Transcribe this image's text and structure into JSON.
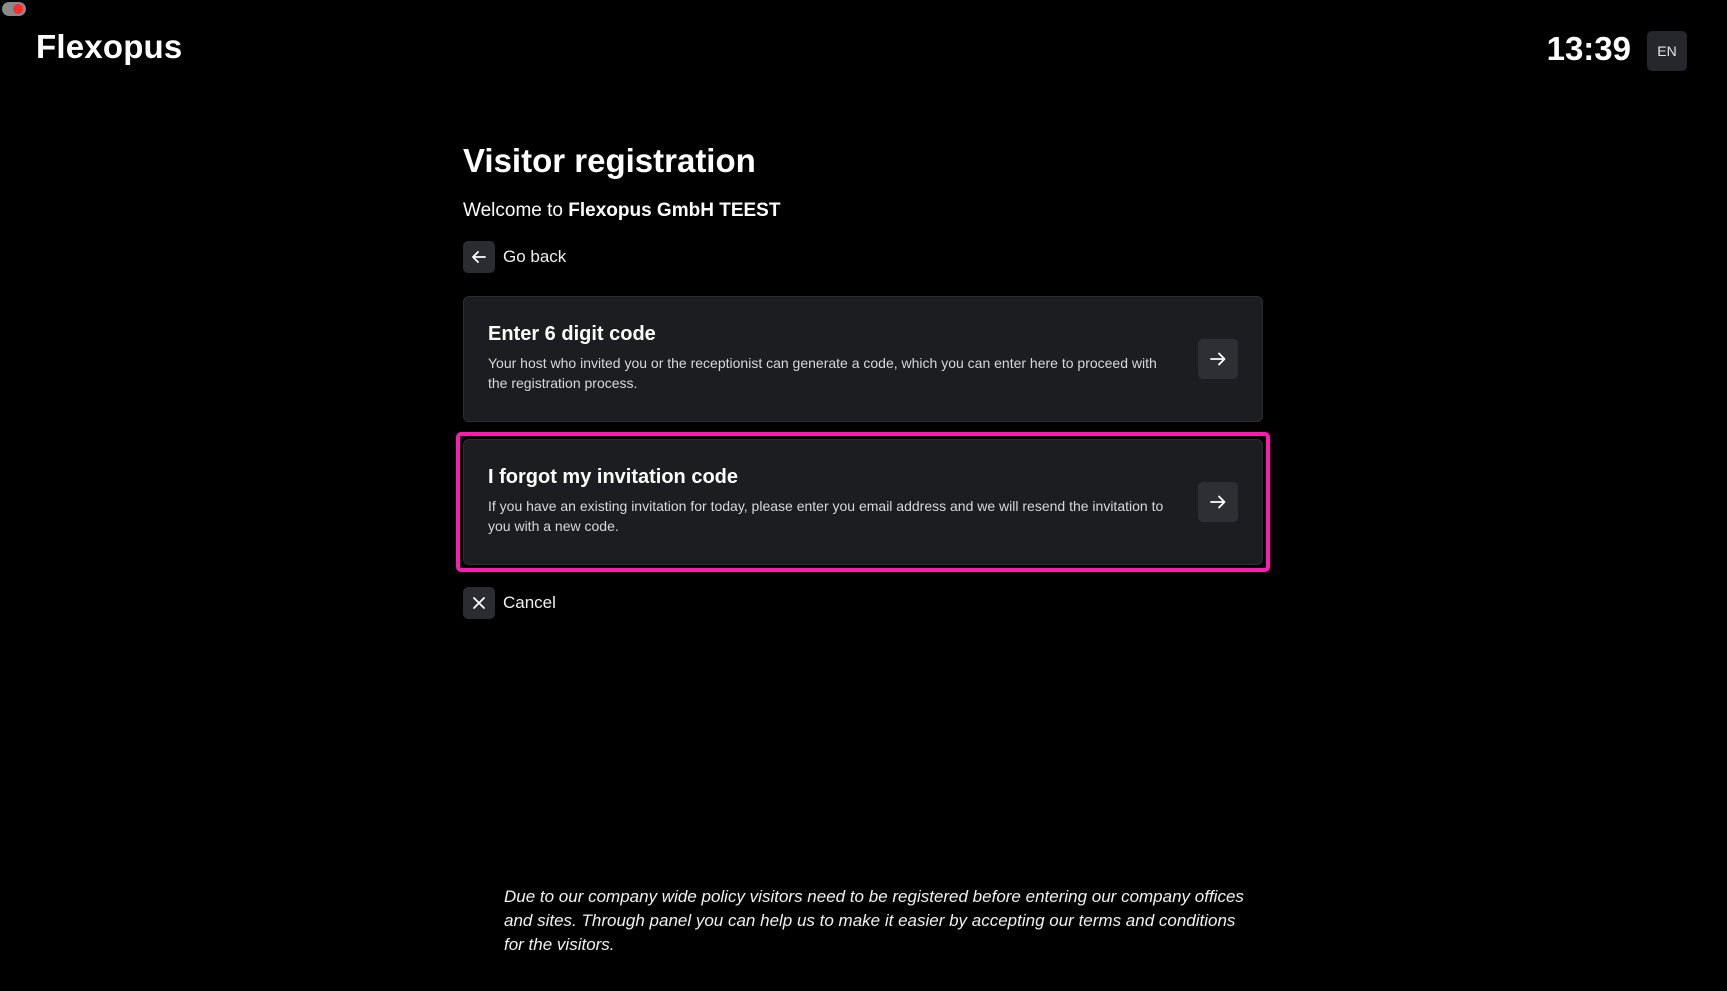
{
  "header": {
    "logo": "Flexopus",
    "time": "13:39",
    "language": "EN"
  },
  "main": {
    "title": "Visitor registration",
    "welcome_prefix": "Welcome to ",
    "company": "Flexopus GmbH TEEST",
    "go_back_label": "Go back",
    "cancel_label": "Cancel",
    "options": [
      {
        "title": "Enter 6 digit code",
        "description": "Your host who invited you or the receptionist can generate a code, which you can enter here to proceed with the registration process."
      },
      {
        "title": "I forgot my invitation code",
        "description": "If you have an existing invitation for today, please enter you email address and we will resend the invitation to you with a new code."
      }
    ]
  },
  "footer": {
    "note": "Due to our company wide policy visitors need to be registered before entering our company offices and sites. Through panel you can help us to make it easier by accepting our terms and conditions for the visitors."
  },
  "colors": {
    "background": "#000000",
    "card": "#1c1d21",
    "highlight": "#ff1ab0"
  },
  "icons": {
    "go_back": "arrow-left-icon",
    "option": "arrow-right-icon",
    "cancel": "close-icon"
  }
}
